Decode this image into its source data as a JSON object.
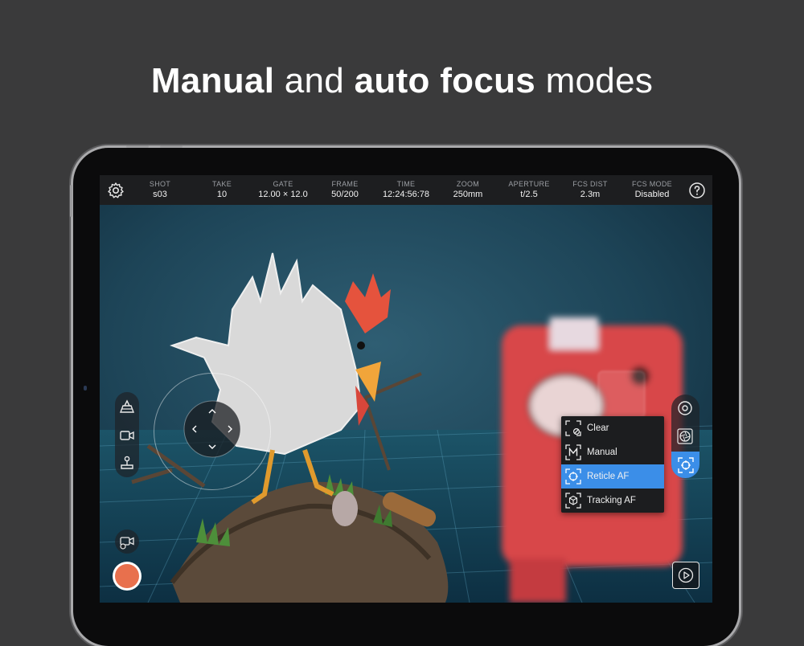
{
  "headline": {
    "part1": "Manual",
    "part2": " and ",
    "part3": "auto focus",
    "part4": " modes"
  },
  "topbar": {
    "items": [
      {
        "label": "SHOT",
        "value": "s03"
      },
      {
        "label": "TAKE",
        "value": "10"
      },
      {
        "label": "GATE",
        "value": "12.00 × 12.0"
      },
      {
        "label": "FRAME",
        "value": "50/200"
      },
      {
        "label": "TIME",
        "value": "12:24:56:78"
      },
      {
        "label": "ZOOM",
        "value": "250mm"
      },
      {
        "label": "APERTURE",
        "value": "t/2.5"
      },
      {
        "label": "FCS DIST",
        "value": "2.3m"
      },
      {
        "label": "FCS MODE",
        "value": "Disabled"
      }
    ],
    "settings_icon": "gear-icon",
    "help_icon": "help-icon"
  },
  "focus_menu": {
    "items": [
      {
        "label": "Clear",
        "icon": "focus-clear-icon",
        "active": false
      },
      {
        "label": "Manual",
        "icon": "focus-manual-icon",
        "active": false
      },
      {
        "label": "Reticle AF",
        "icon": "reticle-af-icon",
        "active": true
      },
      {
        "label": "Tracking AF",
        "icon": "tracking-af-icon",
        "active": false
      }
    ],
    "active_color": "#3b8ee8"
  },
  "colors": {
    "record": "#e8704d",
    "accent": "#3b8ee8"
  }
}
